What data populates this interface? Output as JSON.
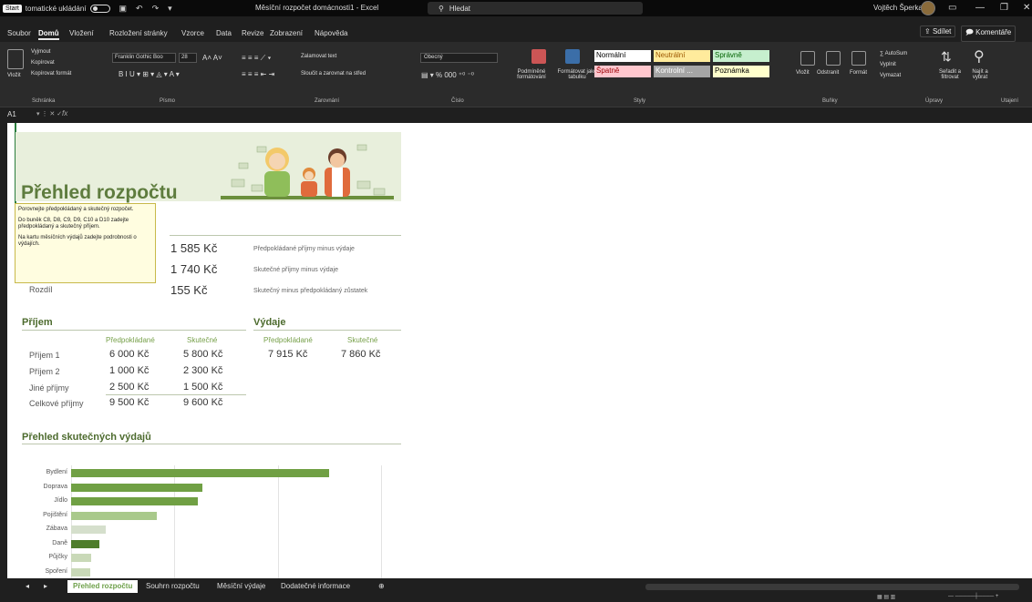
{
  "titlebar": {
    "start": "Start",
    "autosave": "tomatické ukládání",
    "doc_title": "Měsíční rozpočet domácnosti1 - Excel",
    "search": "Hledat",
    "user": "Vojtěch Šperka"
  },
  "menu": {
    "items": [
      "Soubor",
      "Domů",
      "Vložení",
      "Rozložení stránky",
      "Vzorce",
      "Data",
      "Revize",
      "Zobrazení",
      "Nápověda"
    ],
    "share": "Sdílet",
    "comments": "Komentáře"
  },
  "ribbon": {
    "clipboard": {
      "paste": "Vložit",
      "cut": "Vyjmout",
      "copy": "Kopírovat",
      "format_painter": "Kopírovat formát",
      "label": "Schránka"
    },
    "font": {
      "family": "Franklin Gothic Boo",
      "size": "28",
      "label": "Písmo"
    },
    "alignment": {
      "wrap": "Zalamovat text",
      "merge": "Sloučit a zarovnat na střed",
      "label": "Zarovnání"
    },
    "number": {
      "format": "Obecný",
      "label": "Číslo"
    },
    "styles": {
      "conditional": "Podmíněné formátování",
      "format_table": "Formátovat jako tabulku",
      "label": "Styly",
      "cells": [
        {
          "name": "Normální",
          "bg": "#ffffff",
          "fg": "#000000"
        },
        {
          "name": "Neutrální",
          "bg": "#ffeb9c",
          "fg": "#9c5700"
        },
        {
          "name": "Správně",
          "bg": "#c6efce",
          "fg": "#006100"
        },
        {
          "name": "Špatně",
          "bg": "#ffc7ce",
          "fg": "#9c0006"
        },
        {
          "name": "Kontrolní ...",
          "bg": "#a5a5a5",
          "fg": "#ffffff"
        },
        {
          "name": "Poznámka",
          "bg": "#ffffcc",
          "fg": "#000000"
        }
      ]
    },
    "cells": {
      "insert": "Vložit",
      "delete": "Odstranit",
      "format": "Formát",
      "label": "Buňky"
    },
    "editing": {
      "autosum": "AutoSum",
      "fill": "Vyplnit",
      "clear": "Vymazat",
      "sort": "Seřadit a filtrovat",
      "find": "Najít a vybrat",
      "label": "Úpravy"
    },
    "sensitivity": {
      "label": "Utajení"
    }
  },
  "formula": {
    "name_box": "A1",
    "fx": "fx"
  },
  "sheet": {
    "title": "Přehled rozpočtu",
    "tooltip": [
      "Porovnejte předpokládaný a skutečný rozpočet.",
      "Do buněk C8, D8, C9, D9, C10 a D10 zadejte předpokládaný a skutečný příjem.",
      "Na kartu měsíčních výdajů zadejte podrobnosti o výdajích."
    ],
    "summary": [
      {
        "label": "",
        "value": "1 585 Kč",
        "desc": "Předpokládané příjmy minus výdaje"
      },
      {
        "label": "",
        "value": "1 740 Kč",
        "desc": "Skutečné příjmy minus výdaje"
      },
      {
        "label": "Rozdíl",
        "value": "155 Kč",
        "desc": "Skutečný minus předpokládaný zůstatek"
      }
    ],
    "income": {
      "title": "Příjem",
      "col_planned": "Předpokládané",
      "col_actual": "Skutečné",
      "rows": [
        {
          "label": "Příjem 1",
          "planned": "6 000 Kč",
          "actual": "5 800 Kč"
        },
        {
          "label": "Příjem 2",
          "planned": "1 000 Kč",
          "actual": "2 300 Kč"
        },
        {
          "label": "Jiné příjmy",
          "planned": "2 500 Kč",
          "actual": "1 500 Kč"
        },
        {
          "label": "Celkové příjmy",
          "planned": "9 500 Kč",
          "actual": "9 600 Kč"
        }
      ]
    },
    "expenses": {
      "title": "Výdaje",
      "col_planned": "Předpokládané",
      "col_actual": "Skutečné",
      "planned": "7 915 Kč",
      "actual": "7 860 Kč"
    },
    "chart_title": "Přehled skutečných výdajů"
  },
  "chart_data": {
    "type": "bar",
    "orientation": "horizontal",
    "title": "Přehled skutečných výdajů",
    "categories": [
      "Bydlení",
      "Doprava",
      "Jídlo",
      "Pojištění",
      "Zábava",
      "Daně",
      "Půjčky",
      "Spoření"
    ],
    "values": [
      3000,
      1520,
      1470,
      1000,
      400,
      330,
      230,
      220
    ],
    "colors": [
      "#70a044",
      "#70a044",
      "#70a044",
      "#a9c98b",
      "#d5dfcc",
      "#4e7d2b",
      "#c9d9b8",
      "#c9d9b8"
    ],
    "xlim": [
      0,
      3600
    ],
    "grid": true
  },
  "tabs": {
    "items": [
      "Přehled rozpočtu",
      "Souhrn rozpočtu",
      "Měsíční výdaje",
      "Dodatečné informace"
    ],
    "active": 0
  }
}
